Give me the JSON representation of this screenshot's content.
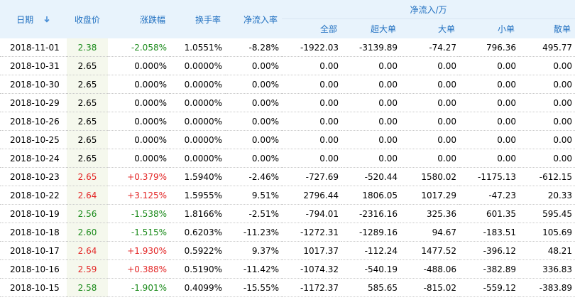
{
  "headers": {
    "date": "日期",
    "close": "收盘价",
    "change": "涨跌幅",
    "turnover": "换手率",
    "inflow_rate": "净流入率",
    "group": "净流入/万",
    "all": "全部",
    "super_large": "超大单",
    "large": "大单",
    "small": "小单",
    "retail": "散单"
  },
  "colors": {
    "up": "#e32626",
    "down": "#1a8a1a",
    "header_text": "#1f6fc0",
    "header_bg": "#e8f3fc"
  },
  "sort_icon": "arrow-down-icon",
  "rows": [
    {
      "date": "2018-11-01",
      "close": "2.38",
      "change": "-2.058%",
      "turnover": "1.0551%",
      "inflow_rate": "-8.28%",
      "all": "-1922.03",
      "super_large": "-3139.89",
      "large": "-74.27",
      "small": "796.36",
      "retail": "495.77",
      "trend": "down"
    },
    {
      "date": "2018-10-31",
      "close": "2.65",
      "change": "0.000%",
      "turnover": "0.0000%",
      "inflow_rate": "0.00%",
      "all": "0.00",
      "super_large": "0.00",
      "large": "0.00",
      "small": "0.00",
      "retail": "0.00",
      "trend": "flat"
    },
    {
      "date": "2018-10-30",
      "close": "2.65",
      "change": "0.000%",
      "turnover": "0.0000%",
      "inflow_rate": "0.00%",
      "all": "0.00",
      "super_large": "0.00",
      "large": "0.00",
      "small": "0.00",
      "retail": "0.00",
      "trend": "flat"
    },
    {
      "date": "2018-10-29",
      "close": "2.65",
      "change": "0.000%",
      "turnover": "0.0000%",
      "inflow_rate": "0.00%",
      "all": "0.00",
      "super_large": "0.00",
      "large": "0.00",
      "small": "0.00",
      "retail": "0.00",
      "trend": "flat"
    },
    {
      "date": "2018-10-26",
      "close": "2.65",
      "change": "0.000%",
      "turnover": "0.0000%",
      "inflow_rate": "0.00%",
      "all": "0.00",
      "super_large": "0.00",
      "large": "0.00",
      "small": "0.00",
      "retail": "0.00",
      "trend": "flat"
    },
    {
      "date": "2018-10-25",
      "close": "2.65",
      "change": "0.000%",
      "turnover": "0.0000%",
      "inflow_rate": "0.00%",
      "all": "0.00",
      "super_large": "0.00",
      "large": "0.00",
      "small": "0.00",
      "retail": "0.00",
      "trend": "flat"
    },
    {
      "date": "2018-10-24",
      "close": "2.65",
      "change": "0.000%",
      "turnover": "0.0000%",
      "inflow_rate": "0.00%",
      "all": "0.00",
      "super_large": "0.00",
      "large": "0.00",
      "small": "0.00",
      "retail": "0.00",
      "trend": "flat"
    },
    {
      "date": "2018-10-23",
      "close": "2.65",
      "change": "+0.379%",
      "turnover": "1.5940%",
      "inflow_rate": "-2.46%",
      "all": "-727.69",
      "super_large": "-520.44",
      "large": "1580.02",
      "small": "-1175.13",
      "retail": "-612.15",
      "trend": "up"
    },
    {
      "date": "2018-10-22",
      "close": "2.64",
      "change": "+3.125%",
      "turnover": "1.5955%",
      "inflow_rate": "9.51%",
      "all": "2796.44",
      "super_large": "1806.05",
      "large": "1017.29",
      "small": "-47.23",
      "retail": "20.33",
      "trend": "up"
    },
    {
      "date": "2018-10-19",
      "close": "2.56",
      "change": "-1.538%",
      "turnover": "1.8166%",
      "inflow_rate": "-2.51%",
      "all": "-794.01",
      "super_large": "-2316.16",
      "large": "325.36",
      "small": "601.35",
      "retail": "595.45",
      "trend": "down"
    },
    {
      "date": "2018-10-18",
      "close": "2.60",
      "change": "-1.515%",
      "turnover": "0.6203%",
      "inflow_rate": "-11.23%",
      "all": "-1272.31",
      "super_large": "-1289.16",
      "large": "94.67",
      "small": "-183.51",
      "retail": "105.69",
      "trend": "down"
    },
    {
      "date": "2018-10-17",
      "close": "2.64",
      "change": "+1.930%",
      "turnover": "0.5922%",
      "inflow_rate": "9.37%",
      "all": "1017.37",
      "super_large": "-112.24",
      "large": "1477.52",
      "small": "-396.12",
      "retail": "48.21",
      "trend": "up"
    },
    {
      "date": "2018-10-16",
      "close": "2.59",
      "change": "+0.388%",
      "turnover": "0.5190%",
      "inflow_rate": "-11.42%",
      "all": "-1074.32",
      "super_large": "-540.19",
      "large": "-488.06",
      "small": "-382.89",
      "retail": "336.83",
      "trend": "up"
    },
    {
      "date": "2018-10-15",
      "close": "2.58",
      "change": "-1.901%",
      "turnover": "0.4099%",
      "inflow_rate": "-15.55%",
      "all": "-1172.37",
      "super_large": "585.65",
      "large": "-815.02",
      "small": "-559.12",
      "retail": "-383.89",
      "trend": "down"
    }
  ]
}
